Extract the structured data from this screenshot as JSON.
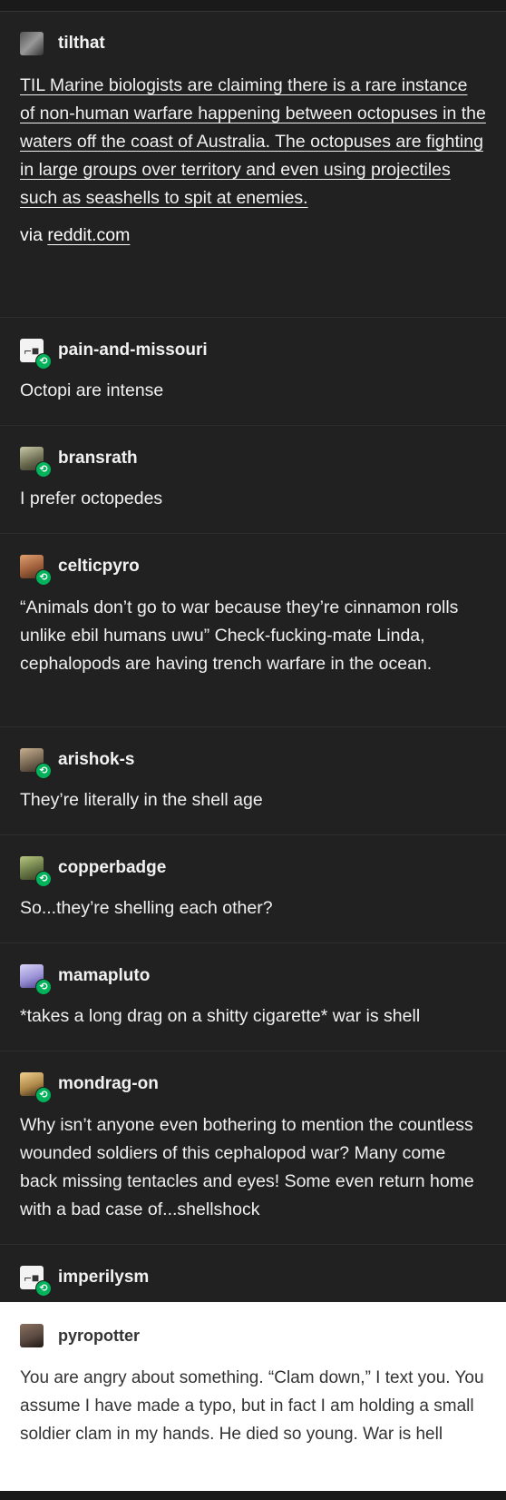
{
  "op": {
    "username": "tilthat",
    "body": "TIL Marine biologists are claiming there is a rare instance of non-human warfare happening between octopuses in the waters off the coast of Australia. The octopuses are fighting in large groups over territory and even using projectiles such as seashells to spit at enemies.",
    "via_prefix": "via ",
    "via_link": "reddit.com",
    "avatar_color": "#6b6b6b"
  },
  "reblogs": [
    {
      "username": "pain-and-missouri",
      "text": "Octopi are intense",
      "avatar_icon": "sunglasses-icon",
      "avatar_color": "#f3f3f3"
    },
    {
      "username": "bransrath",
      "text": "I prefer octopedes",
      "avatar_icon": "avatar-photo",
      "avatar_color": "#8a8a6a"
    },
    {
      "username": "celticpyro",
      "text": "“Animals don’t go to war because they’re cinnamon rolls unlike ebil humans uwu” Check-fucking-mate Linda, cephalopods are having trench warfare in the ocean.",
      "avatar_icon": "avatar-photo",
      "avatar_color": "#a0603c"
    },
    {
      "username": "arishok-s",
      "text": "They’re literally in the shell age",
      "avatar_icon": "avatar-photo",
      "avatar_color": "#7a6a55"
    },
    {
      "username": "copperbadge",
      "text": "So...they’re shelling each other?",
      "avatar_icon": "avatar-photo",
      "avatar_color": "#6a7a48"
    },
    {
      "username": "mamapluto",
      "text": "*takes a long drag on a shitty cigarette* war is shell",
      "avatar_icon": "avatar-photo",
      "avatar_color": "#9b93d6"
    },
    {
      "username": "mondrag-on",
      "text": "Why isn’t anyone even bothering to mention the countless wounded soldiers of this cephalopod war? Many come back missing tentacles and eyes! Some even return home with a bad case of...shellshock",
      "avatar_icon": "avatar-photo",
      "avatar_color": "#b08a4a"
    },
    {
      "username": "imperilysm",
      "text": "",
      "avatar_icon": "sunglasses-icon",
      "avatar_color": "#f3f3f3"
    }
  ],
  "final": {
    "username": "pyropotter",
    "text": "You are angry about something. “Clam down,” I text you. You assume I have made a typo, but in fact I am holding a small soldier clam in my hands. He died so young. War is hell",
    "avatar_color": "#5a4a40"
  },
  "colors": {
    "background": "#212121",
    "reblog_badge": "#00b35a",
    "card": "#ffffff"
  }
}
